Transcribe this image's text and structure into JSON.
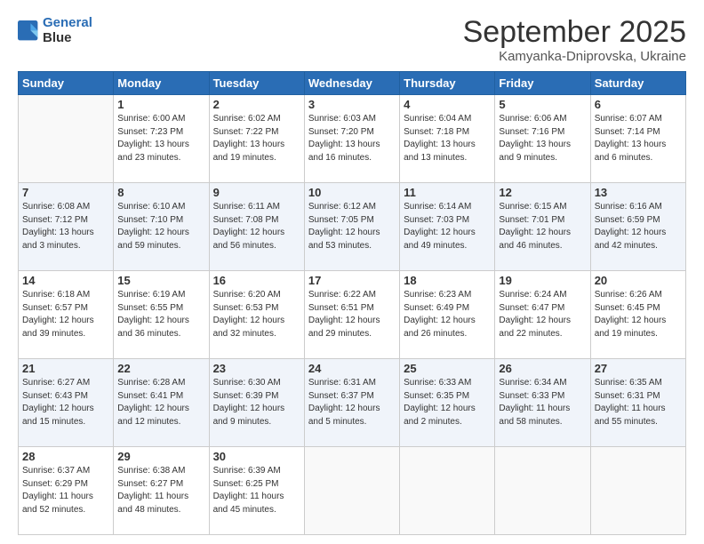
{
  "logo": {
    "line1": "General",
    "line2": "Blue"
  },
  "title": "September 2025",
  "subtitle": "Kamyanka-Dniprovska, Ukraine",
  "weekdays": [
    "Sunday",
    "Monday",
    "Tuesday",
    "Wednesday",
    "Thursday",
    "Friday",
    "Saturday"
  ],
  "weeks": [
    [
      {
        "num": "",
        "info": ""
      },
      {
        "num": "1",
        "info": "Sunrise: 6:00 AM\nSunset: 7:23 PM\nDaylight: 13 hours\nand 23 minutes."
      },
      {
        "num": "2",
        "info": "Sunrise: 6:02 AM\nSunset: 7:22 PM\nDaylight: 13 hours\nand 19 minutes."
      },
      {
        "num": "3",
        "info": "Sunrise: 6:03 AM\nSunset: 7:20 PM\nDaylight: 13 hours\nand 16 minutes."
      },
      {
        "num": "4",
        "info": "Sunrise: 6:04 AM\nSunset: 7:18 PM\nDaylight: 13 hours\nand 13 minutes."
      },
      {
        "num": "5",
        "info": "Sunrise: 6:06 AM\nSunset: 7:16 PM\nDaylight: 13 hours\nand 9 minutes."
      },
      {
        "num": "6",
        "info": "Sunrise: 6:07 AM\nSunset: 7:14 PM\nDaylight: 13 hours\nand 6 minutes."
      }
    ],
    [
      {
        "num": "7",
        "info": "Sunrise: 6:08 AM\nSunset: 7:12 PM\nDaylight: 13 hours\nand 3 minutes."
      },
      {
        "num": "8",
        "info": "Sunrise: 6:10 AM\nSunset: 7:10 PM\nDaylight: 12 hours\nand 59 minutes."
      },
      {
        "num": "9",
        "info": "Sunrise: 6:11 AM\nSunset: 7:08 PM\nDaylight: 12 hours\nand 56 minutes."
      },
      {
        "num": "10",
        "info": "Sunrise: 6:12 AM\nSunset: 7:05 PM\nDaylight: 12 hours\nand 53 minutes."
      },
      {
        "num": "11",
        "info": "Sunrise: 6:14 AM\nSunset: 7:03 PM\nDaylight: 12 hours\nand 49 minutes."
      },
      {
        "num": "12",
        "info": "Sunrise: 6:15 AM\nSunset: 7:01 PM\nDaylight: 12 hours\nand 46 minutes."
      },
      {
        "num": "13",
        "info": "Sunrise: 6:16 AM\nSunset: 6:59 PM\nDaylight: 12 hours\nand 42 minutes."
      }
    ],
    [
      {
        "num": "14",
        "info": "Sunrise: 6:18 AM\nSunset: 6:57 PM\nDaylight: 12 hours\nand 39 minutes."
      },
      {
        "num": "15",
        "info": "Sunrise: 6:19 AM\nSunset: 6:55 PM\nDaylight: 12 hours\nand 36 minutes."
      },
      {
        "num": "16",
        "info": "Sunrise: 6:20 AM\nSunset: 6:53 PM\nDaylight: 12 hours\nand 32 minutes."
      },
      {
        "num": "17",
        "info": "Sunrise: 6:22 AM\nSunset: 6:51 PM\nDaylight: 12 hours\nand 29 minutes."
      },
      {
        "num": "18",
        "info": "Sunrise: 6:23 AM\nSunset: 6:49 PM\nDaylight: 12 hours\nand 26 minutes."
      },
      {
        "num": "19",
        "info": "Sunrise: 6:24 AM\nSunset: 6:47 PM\nDaylight: 12 hours\nand 22 minutes."
      },
      {
        "num": "20",
        "info": "Sunrise: 6:26 AM\nSunset: 6:45 PM\nDaylight: 12 hours\nand 19 minutes."
      }
    ],
    [
      {
        "num": "21",
        "info": "Sunrise: 6:27 AM\nSunset: 6:43 PM\nDaylight: 12 hours\nand 15 minutes."
      },
      {
        "num": "22",
        "info": "Sunrise: 6:28 AM\nSunset: 6:41 PM\nDaylight: 12 hours\nand 12 minutes."
      },
      {
        "num": "23",
        "info": "Sunrise: 6:30 AM\nSunset: 6:39 PM\nDaylight: 12 hours\nand 9 minutes."
      },
      {
        "num": "24",
        "info": "Sunrise: 6:31 AM\nSunset: 6:37 PM\nDaylight: 12 hours\nand 5 minutes."
      },
      {
        "num": "25",
        "info": "Sunrise: 6:33 AM\nSunset: 6:35 PM\nDaylight: 12 hours\nand 2 minutes."
      },
      {
        "num": "26",
        "info": "Sunrise: 6:34 AM\nSunset: 6:33 PM\nDaylight: 11 hours\nand 58 minutes."
      },
      {
        "num": "27",
        "info": "Sunrise: 6:35 AM\nSunset: 6:31 PM\nDaylight: 11 hours\nand 55 minutes."
      }
    ],
    [
      {
        "num": "28",
        "info": "Sunrise: 6:37 AM\nSunset: 6:29 PM\nDaylight: 11 hours\nand 52 minutes."
      },
      {
        "num": "29",
        "info": "Sunrise: 6:38 AM\nSunset: 6:27 PM\nDaylight: 11 hours\nand 48 minutes."
      },
      {
        "num": "30",
        "info": "Sunrise: 6:39 AM\nSunset: 6:25 PM\nDaylight: 11 hours\nand 45 minutes."
      },
      {
        "num": "",
        "info": ""
      },
      {
        "num": "",
        "info": ""
      },
      {
        "num": "",
        "info": ""
      },
      {
        "num": "",
        "info": ""
      }
    ]
  ]
}
